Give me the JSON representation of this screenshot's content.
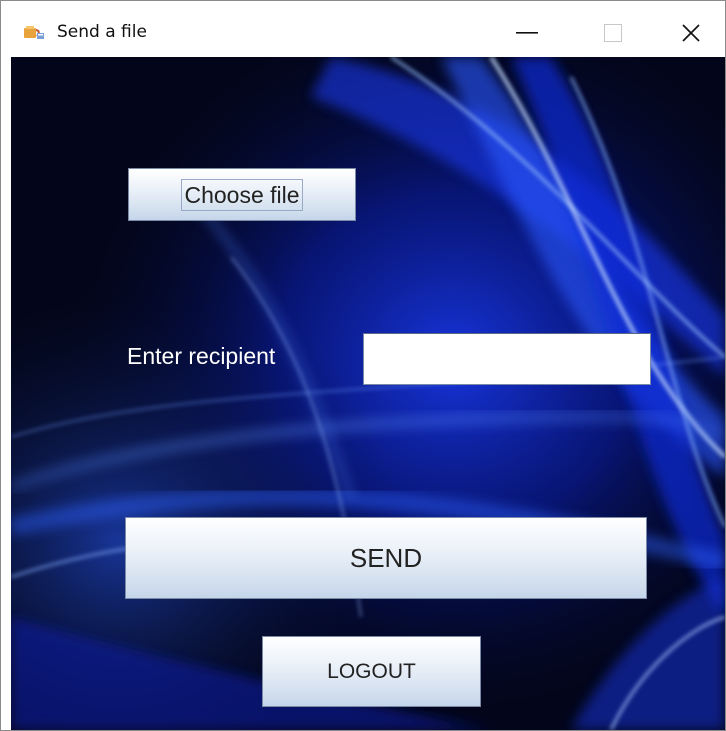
{
  "window": {
    "title": "Send a file",
    "icon": "java-cup-icon",
    "controls": {
      "minimize": "minimize-icon",
      "maximize": "maximize-icon",
      "close": "close-icon"
    }
  },
  "form": {
    "choose_file_label": "Choose file",
    "recipient_label": "Enter recipient",
    "recipient_value": "",
    "send_label": "SEND",
    "logout_label": "LOGOUT"
  },
  "colors": {
    "background": "#03061a",
    "accent_blue": "#1a4dff",
    "button_top": "#ffffff",
    "button_bottom": "#c5d5ea",
    "label_text": "#ffffff"
  }
}
